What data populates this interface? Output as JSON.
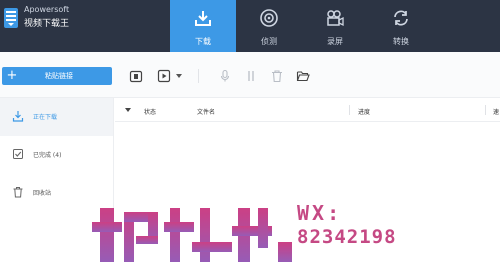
{
  "app": {
    "brand_name": "Apowersoft",
    "product_name": "视频下载王"
  },
  "tabs": [
    {
      "label": "下载",
      "icon": "download-icon",
      "active": true
    },
    {
      "label": "侦测",
      "icon": "detect-icon",
      "active": false
    },
    {
      "label": "录屏",
      "icon": "record-screen-icon",
      "active": false
    },
    {
      "label": "转换",
      "icon": "convert-icon",
      "active": false
    }
  ],
  "toolbar": {
    "add_label": "粘贴链接",
    "icons": [
      "paste-icon",
      "play-icon",
      "microphone-icon",
      "pause-icon",
      "delete-icon",
      "folder-open-icon"
    ]
  },
  "sidebar": {
    "items": [
      {
        "label": "正在下载",
        "icon": "download-icon",
        "active": true
      },
      {
        "label": "已完成 (4)",
        "icon": "check-icon",
        "active": false
      },
      {
        "label": "回收站",
        "icon": "trash-icon",
        "active": false
      }
    ]
  },
  "table": {
    "columns": [
      "状态",
      "文件名",
      "进度",
      "速"
    ]
  },
  "watermark": {
    "line1": "WX:",
    "line2": "82342198"
  },
  "colors": {
    "header_bg": "#2c3444",
    "accent": "#3d99e6",
    "watermark": "#c13a7a"
  }
}
